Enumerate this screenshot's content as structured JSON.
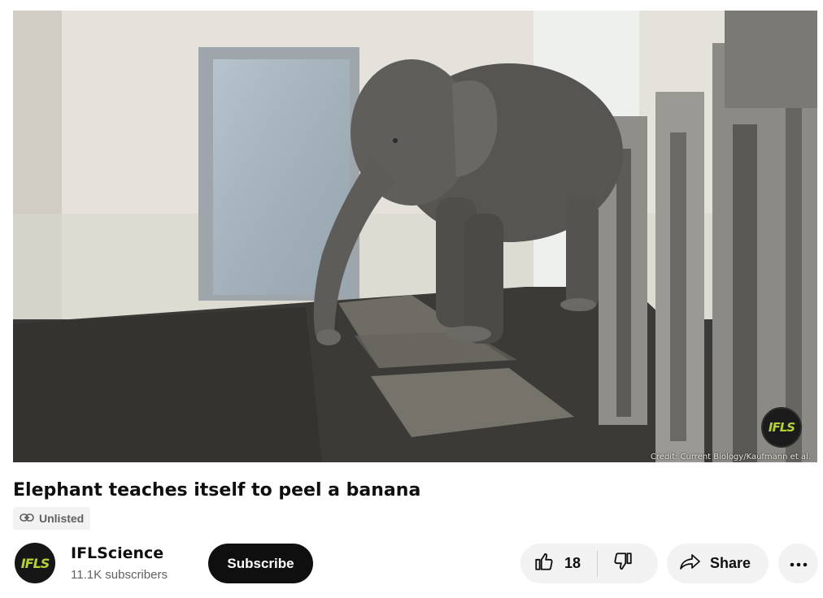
{
  "video": {
    "credit": "Credit: Current Biology/Kaufmann et al.",
    "watermark": "IFLS"
  },
  "title": "Elephant teaches itself to peel a banana",
  "visibility_badge": {
    "icon": "link-icon",
    "label": "Unlisted"
  },
  "channel": {
    "avatar_text": "IFLS",
    "name": "IFLScience",
    "subscribers": "11.1K subscribers",
    "subscribe_label": "Subscribe"
  },
  "actions": {
    "like_icon": "thumbs-up-icon",
    "like_count": "18",
    "dislike_icon": "thumbs-down-icon",
    "share_icon": "share-arrow-icon",
    "share_label": "Share",
    "more_icon": "more-horizontal-icon"
  },
  "colors": {
    "brand_lime": "#b4d336",
    "subscribe_bg": "#0f0f0f",
    "pill_bg": "#f2f2f2",
    "secondary_text": "#606060"
  }
}
